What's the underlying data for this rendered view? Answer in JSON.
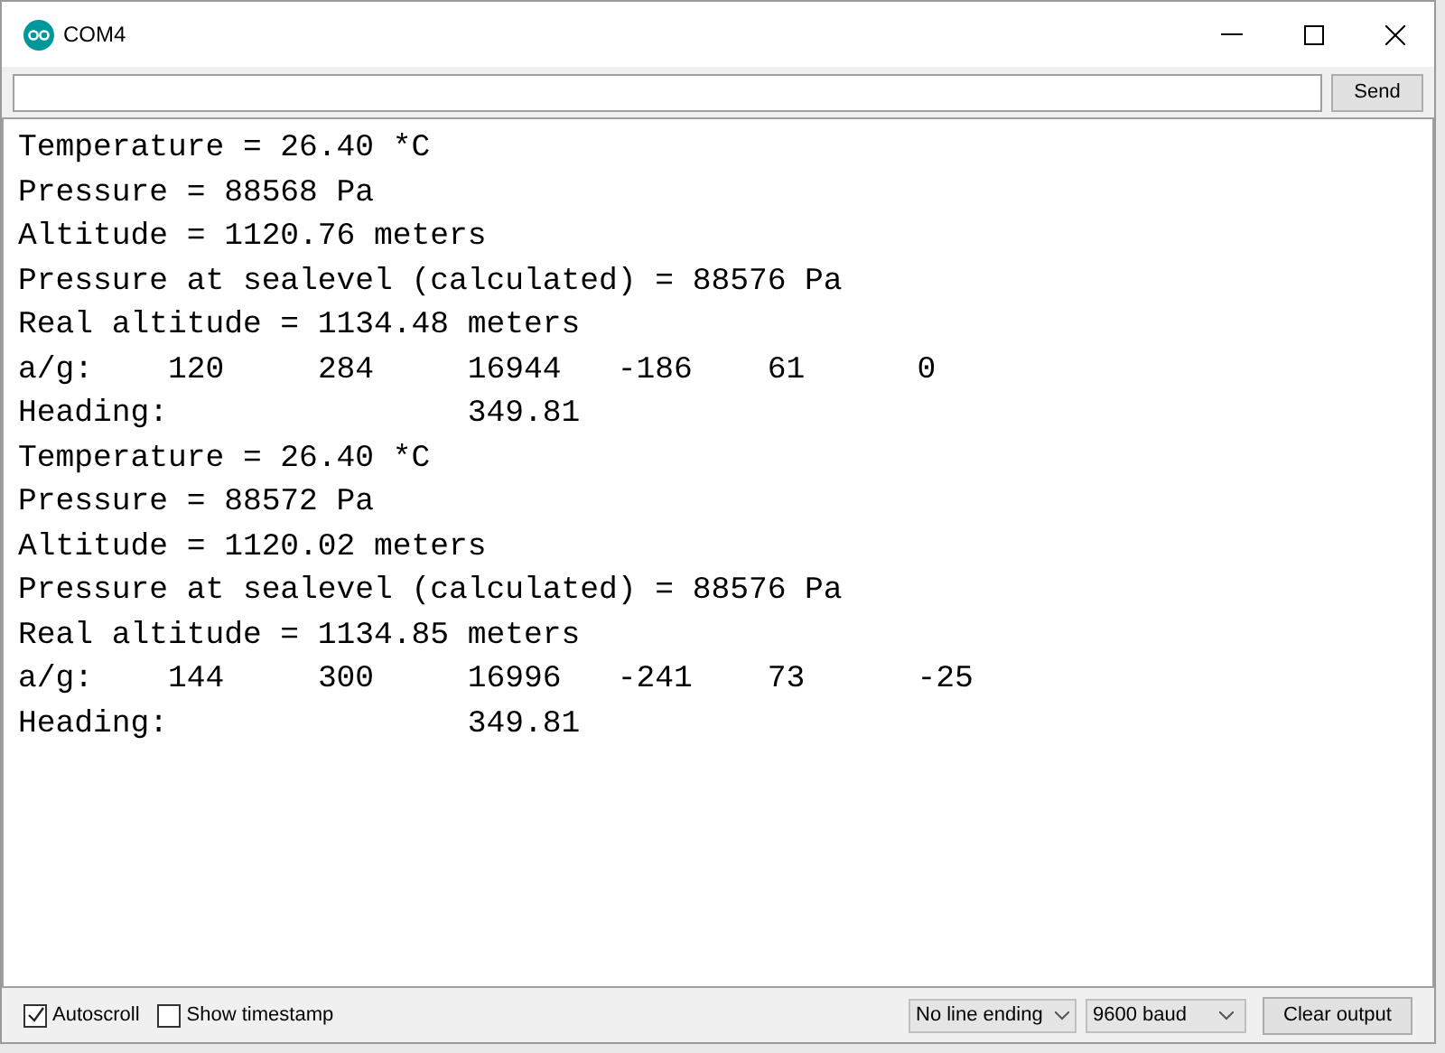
{
  "window": {
    "title": "COM4"
  },
  "send_button": "Send",
  "output_lines": [
    "Temperature = 26.40 *C",
    "Pressure = 88568 Pa",
    "Altitude = 1120.76 meters",
    "Pressure at sealevel (calculated) = 88576 Pa",
    "Real altitude = 1134.48 meters",
    "a/g:\t120\t284\t16944\t-186\t61\t0",
    "Heading:\t\t349.81",
    "Temperature = 26.40 *C",
    "Pressure = 88572 Pa",
    "Altitude = 1120.02 meters",
    "Pressure at sealevel (calculated) = 88576 Pa",
    "Real altitude = 1134.85 meters",
    "a/g:\t144\t300\t16996\t-241\t73\t-25",
    "Heading:\t\t349.81"
  ],
  "checkboxes": [
    {
      "label": "Autoscroll",
      "checked": true
    },
    {
      "label": "Show timestamp",
      "checked": false
    }
  ],
  "line_ending": "No line ending",
  "baud_rate": "9600 baud",
  "clear_button": "Clear output"
}
